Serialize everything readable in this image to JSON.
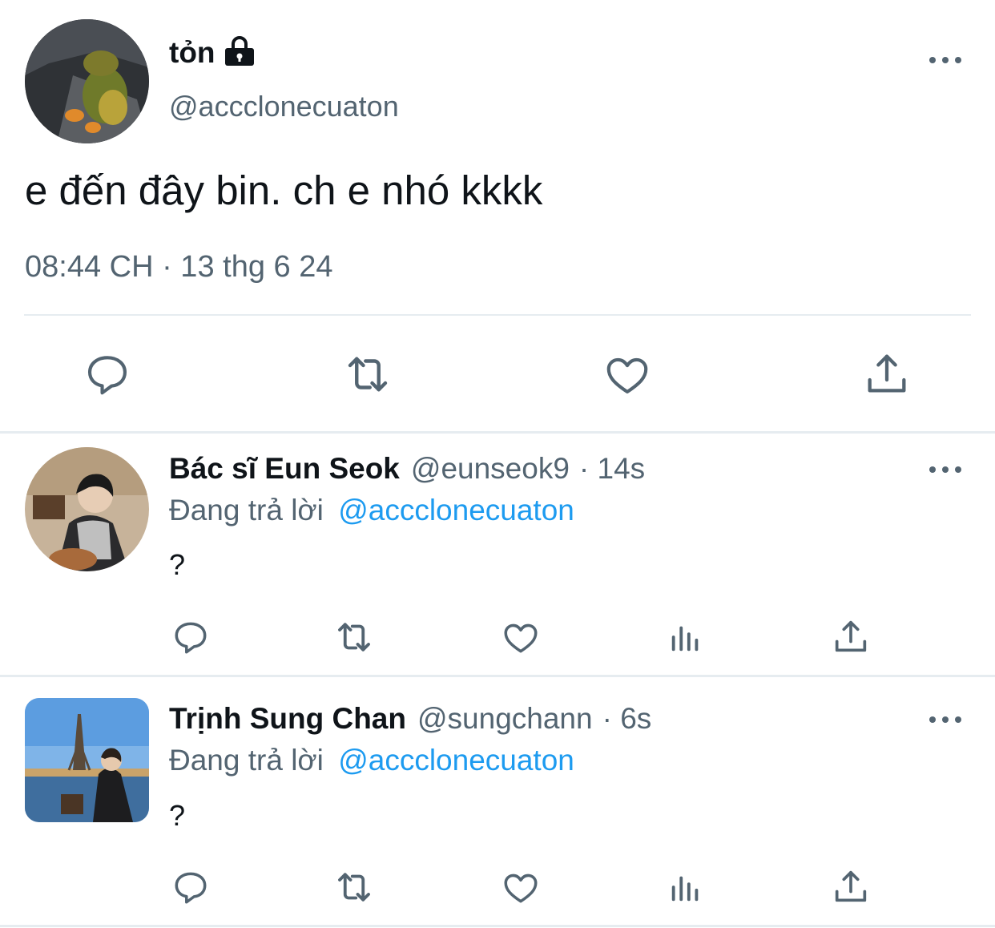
{
  "main_tweet": {
    "display_name": "tỏn",
    "handle": "@accclonecuaton",
    "text": "e đến đây bin. ch e nhó kkkk",
    "timestamp": "08:44 CH · 13 thg 6 24",
    "actions": [
      "reply-icon",
      "retweet-icon",
      "like-icon",
      "share-icon"
    ]
  },
  "replies": [
    {
      "display_name": "Bác sĩ Eun Seok",
      "handle": "@eunseok9",
      "time": "· 14s",
      "replying_label": "Đang trả lời",
      "replying_to": "@accclonecuaton",
      "text": "?"
    },
    {
      "display_name": "Trịnh Sung Chan",
      "handle": "@sungchann",
      "time": "· 6s",
      "replying_label": "Đang trả lời",
      "replying_to": "@accclonecuaton",
      "text": "?"
    }
  ],
  "colors": {
    "text": "#0f1419",
    "muted": "#536471",
    "link": "#1d9bf0",
    "divider": "#e6ecf0"
  }
}
